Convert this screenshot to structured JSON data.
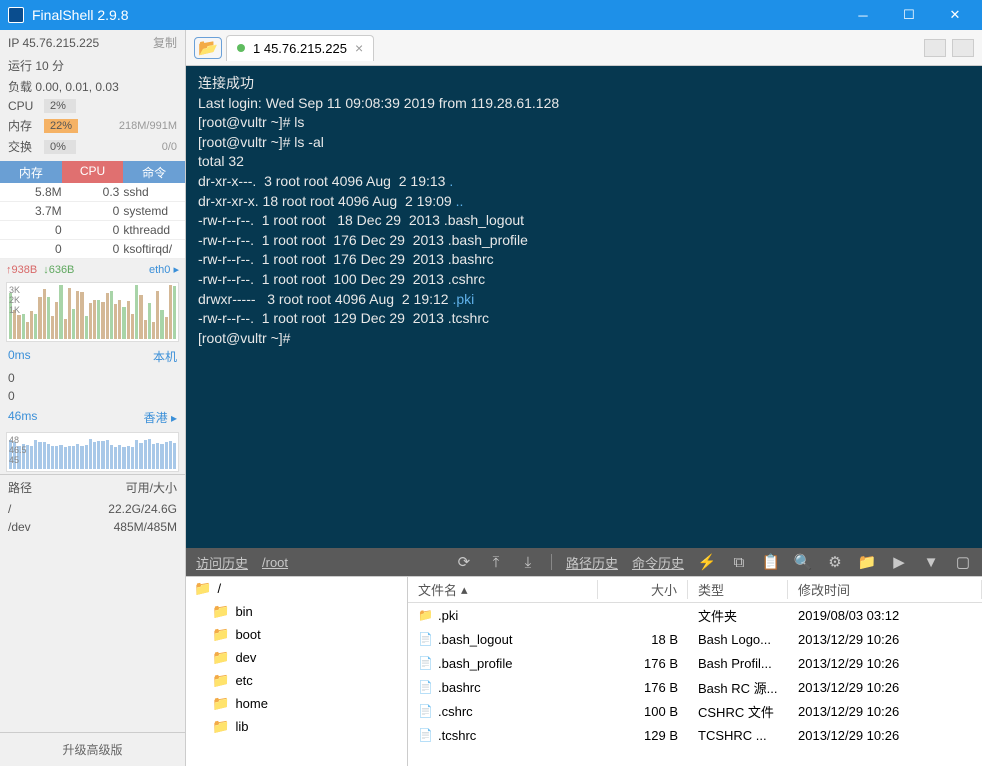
{
  "app": {
    "title": "FinalShell 2.9.8"
  },
  "sidebar": {
    "ip_label": "IP 45.76.215.225",
    "copy": "复制",
    "uptime": "运行 10 分",
    "load": "负载 0.00, 0.01, 0.03",
    "cpu_label": "CPU",
    "cpu_pct": "2%",
    "mem_label": "内存",
    "mem_pct": "22%",
    "mem_extra": "218M/991M",
    "swap_label": "交换",
    "swap_pct": "0%",
    "swap_extra": "0/0",
    "proc_headers": [
      "内存",
      "CPU",
      "命令"
    ],
    "procs": [
      {
        "mem": "5.8M",
        "cpu": "0.3",
        "cmd": "sshd"
      },
      {
        "mem": "3.7M",
        "cpu": "0",
        "cmd": "systemd"
      },
      {
        "mem": "0",
        "cpu": "0",
        "cmd": "kthreadd"
      },
      {
        "mem": "0",
        "cpu": "0",
        "cmd": "ksoftirqd/"
      }
    ],
    "net_up": "↑938B",
    "net_dn": "↓636B",
    "net_iface": "eth0 ▸",
    "chart_axis": [
      "3K",
      "2K",
      "1K"
    ],
    "lat1_val": "0ms",
    "lat1_loc": "本机",
    "lat1_rows": [
      "0",
      "0"
    ],
    "lat2_val": "46ms",
    "lat2_loc": "香港 ▸",
    "lat2_rows": [
      "48",
      "46.5",
      "45"
    ],
    "disk_h1": "路径",
    "disk_h2": "可用/大小",
    "disks": [
      {
        "p": "/",
        "v": "22.2G/24.6G"
      },
      {
        "p": "/dev",
        "v": "485M/485M"
      }
    ],
    "upgrade": "升级高级版"
  },
  "tab": {
    "label": "1 45.76.215.225"
  },
  "terminal": {
    "lines": [
      {
        "t": "连接成功"
      },
      {
        "t": "Last login: Wed Sep 11 09:08:39 2019 from 119.28.61.128"
      },
      {
        "t": "[root@vultr ~]# ls"
      },
      {
        "t": "[root@vultr ~]# ls -al"
      },
      {
        "t": "total 32"
      },
      {
        "t": "dr-xr-x---.  3 root root 4096 Aug  2 19:13 ",
        "suffix": ".",
        "blue": true
      },
      {
        "t": "dr-xr-xr-x. 18 root root 4096 Aug  2 19:09 ",
        "suffix": "..",
        "blue": true
      },
      {
        "t": "-rw-r--r--.  1 root root   18 Dec 29  2013 .bash_logout"
      },
      {
        "t": "-rw-r--r--.  1 root root  176 Dec 29  2013 .bash_profile"
      },
      {
        "t": "-rw-r--r--.  1 root root  176 Dec 29  2013 .bashrc"
      },
      {
        "t": "-rw-r--r--.  1 root root  100 Dec 29  2013 .cshrc"
      },
      {
        "t": "drwxr-----   3 root root 4096 Aug  2 19:12 ",
        "suffix": ".pki",
        "blue": true
      },
      {
        "t": "-rw-r--r--.  1 root root  129 Dec 29  2013 .tcshrc"
      },
      {
        "t": "[root@vultr ~]# "
      }
    ]
  },
  "bottombar": {
    "history": "访问历史",
    "path": "/root",
    "path_hist": "路径历史",
    "cmd_hist": "命令历史"
  },
  "tree": {
    "root": "/",
    "items": [
      "bin",
      "boot",
      "dev",
      "etc",
      "home",
      "lib"
    ]
  },
  "filelist": {
    "headers": {
      "name": "文件名",
      "size": "大小",
      "type": "类型",
      "mod": "修改时间"
    },
    "rows": [
      {
        "icon": "folder",
        "name": ".pki",
        "size": "",
        "type": "文件夹",
        "mod": "2019/08/03 03:12"
      },
      {
        "icon": "file",
        "name": ".bash_logout",
        "size": "18 B",
        "type": "Bash Logo...",
        "mod": "2013/12/29 10:26"
      },
      {
        "icon": "file",
        "name": ".bash_profile",
        "size": "176 B",
        "type": "Bash Profil...",
        "mod": "2013/12/29 10:26"
      },
      {
        "icon": "file",
        "name": ".bashrc",
        "size": "176 B",
        "type": "Bash RC 源...",
        "mod": "2013/12/29 10:26"
      },
      {
        "icon": "file",
        "name": ".cshrc",
        "size": "100 B",
        "type": "CSHRC 文件",
        "mod": "2013/12/29 10:26"
      },
      {
        "icon": "file",
        "name": ".tcshrc",
        "size": "129 B",
        "type": "TCSHRC ...",
        "mod": "2013/12/29 10:26"
      }
    ]
  }
}
